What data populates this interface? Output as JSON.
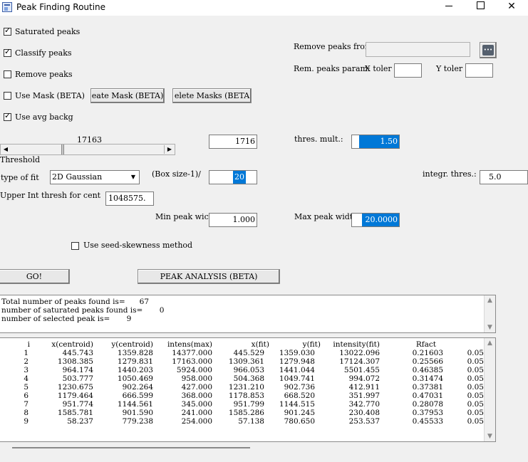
{
  "window": {
    "title": "Peak Finding Routine",
    "controls": {
      "minimize": "minimize",
      "maximize": "maximize",
      "close": "✕"
    }
  },
  "options": {
    "saturated_peaks": {
      "label": "Saturated peaks",
      "checked": true
    },
    "classify_peaks": {
      "label": "Classify peaks",
      "checked": true
    },
    "remove_peaks": {
      "label": "Remove peaks",
      "checked": false
    },
    "use_mask": {
      "label": "Use Mask (BETA)",
      "checked": false
    },
    "use_avg_backg": {
      "label": "Use avg backg",
      "checked": true
    },
    "use_seed_skewness": {
      "label": "Use seed-skewness method",
      "checked": false
    }
  },
  "mask_buttons": {
    "create": "eate Mask (BETA)",
    "delete": "elete Masks (BETA"
  },
  "remove_from": {
    "label": "Remove peaks from",
    "value": "",
    "browse_label": "•••"
  },
  "rem_params": {
    "label": "Rem. peaks param:",
    "x_label": "X toler",
    "x_value": "",
    "y_label": "Y toler",
    "y_value": ""
  },
  "threshold": {
    "slider_value": "17163",
    "field_value": "1716",
    "label": "Threshold",
    "slider_fraction": 0.33
  },
  "thres_mult": {
    "label": "thres. mult.:",
    "value": "1.50"
  },
  "type_of_fit": {
    "label": "type of fit",
    "value": "2D Gaussian"
  },
  "box_size": {
    "label": "(Box size-1)/",
    "value": "20"
  },
  "integr_thres": {
    "label": "integr. thres.:",
    "value": "5.0"
  },
  "upper_int": {
    "label": "Upper Int thresh for cent",
    "value": "1048575."
  },
  "min_peak": {
    "label": "Min peak wic",
    "value": "1.000"
  },
  "max_peak": {
    "label": "Max peak widt",
    "value": "20.0000"
  },
  "actions": {
    "go": "GO!",
    "peak_analysis": "PEAK ANALYSIS (BETA)"
  },
  "summary": {
    "lines": [
      "Total number of peaks found is=      67",
      "number of saturated peaks found is=       0",
      "number of selected peak is=       9"
    ]
  },
  "results": {
    "headers": [
      "i",
      "x(centroid)",
      "y(centroid)",
      "intens(max)",
      "x(fit)",
      "y(fit)",
      "intensity(fit)",
      "Rfact"
    ],
    "rows": [
      [
        "1",
        "445.743",
        "1359.828",
        "14377.000",
        "445.529",
        "1359.030",
        "13022.096",
        "0.21603",
        "0.05"
      ],
      [
        "2",
        "1308.385",
        "1279.831",
        "17163.000",
        "1309.361",
        "1279.948",
        "17124.307",
        "0.25566",
        "0.05"
      ],
      [
        "3",
        "964.174",
        "1440.203",
        "5924.000",
        "966.053",
        "1441.044",
        "5501.455",
        "0.46385",
        "0.05"
      ],
      [
        "4",
        "503.777",
        "1050.469",
        "958.000",
        "504.368",
        "1049.741",
        "994.072",
        "0.31474",
        "0.05"
      ],
      [
        "5",
        "1230.675",
        "902.264",
        "427.000",
        "1231.210",
        "902.736",
        "412.911",
        "0.37381",
        "0.05"
      ],
      [
        "6",
        "1179.464",
        "666.599",
        "368.000",
        "1178.853",
        "668.520",
        "351.997",
        "0.47031",
        "0.05"
      ],
      [
        "7",
        "951.774",
        "1144.561",
        "345.000",
        "951.799",
        "1144.515",
        "342.770",
        "0.28078",
        "0.05"
      ],
      [
        "8",
        "1585.781",
        "901.590",
        "241.000",
        "1585.286",
        "901.245",
        "230.408",
        "0.37953",
        "0.05"
      ],
      [
        "9",
        "58.237",
        "779.238",
        "254.000",
        "57.138",
        "780.650",
        "253.537",
        "0.45533",
        "0.05"
      ]
    ]
  },
  "scroll_arrows": {
    "up": "▲",
    "down": "▼",
    "left": "◀",
    "right": "▶"
  }
}
